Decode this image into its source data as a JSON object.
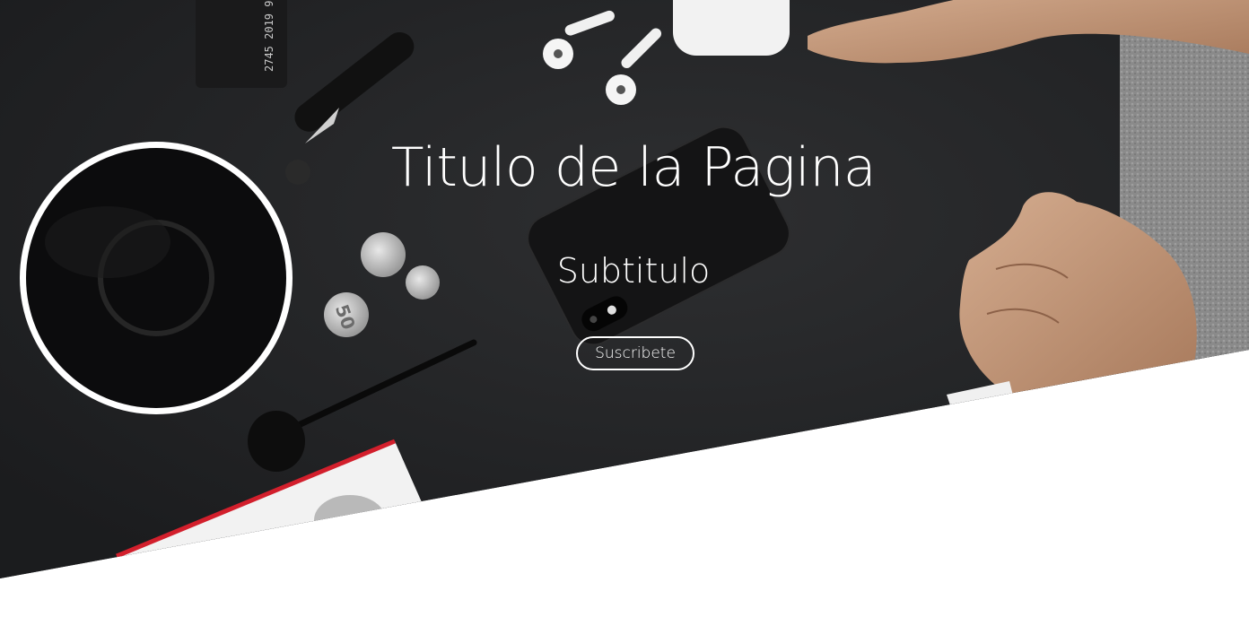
{
  "hero": {
    "title": "Titulo de la Pagina",
    "subtitle": "Subtitulo",
    "cta_label": "Suscribete",
    "card_number_text": "2745 2019 9",
    "coin_label": "50"
  },
  "colors": {
    "table": "#222325",
    "carpet": "#8a8a8a",
    "skin": "#c49a7c",
    "text": "#ffffff",
    "page_background": "#ffffff"
  }
}
